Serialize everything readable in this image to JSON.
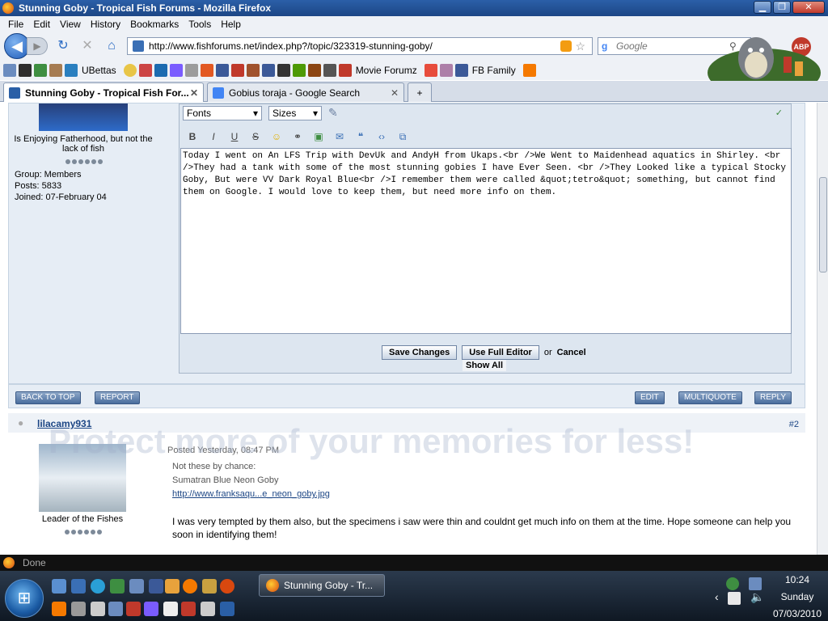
{
  "window": {
    "title": "Stunning Goby - Tropical Fish Forums - Mozilla Firefox",
    "min": "▁",
    "max": "❐",
    "close": "✕"
  },
  "menu": [
    "File",
    "Edit",
    "View",
    "History",
    "Bookmarks",
    "Tools",
    "Help"
  ],
  "nav": {
    "url": "http://www.fishforums.net/index.php?/topic/323319-stunning-goby/",
    "search_placeholder": "Google",
    "search_engine": "g",
    "abp": "ABP"
  },
  "bookmarks": {
    "ubettas": "UBettas",
    "movie_forumz": "Movie Forumz",
    "fb_family": "FB Family",
    "colors": [
      "#6b8cbf",
      "#2d2d2d",
      "#3e8e41",
      "#a67c52",
      "#2a7fbf",
      "#e8c547",
      "#cc4444",
      "#1c6bb0",
      "#7a5cff",
      "#9c9c9c",
      "#e25822",
      "#3b5998",
      "#c0392b",
      "#a0522d",
      "#3b5998",
      "#333333",
      "#4e9a06",
      "#8b4513",
      "#555555",
      "#c0392b",
      "#e74c3c",
      "#ad7fa8",
      "#3b5998",
      "#f57900"
    ]
  },
  "tabs": [
    {
      "label": "Stunning Goby - Tropical Fish For...",
      "close": "✕"
    },
    {
      "label": "Gobius toraja - Google Search",
      "close": "✕"
    },
    {
      "label": "+"
    }
  ],
  "post1": {
    "title": "Is Enjoying Fatherhood, but not the lack of fish",
    "group": "Group: Members",
    "posts": "Posts: 5833",
    "joined": "Joined: 07-February 04"
  },
  "editor": {
    "fonts": "Fonts",
    "sizes": "Sizes",
    "text": "Today I went on An LFS Trip with DevUk and AndyH from Ukaps.<br />We Went to Maidenhead aquatics in Shirley. <br />They had a tank with some of the most stunning gobies I have Ever Seen. <br />They Looked like a typical Stocky Goby, But were VV Dark Royal Blue<br />I remember them were called &quot;tetro&quot; something, but cannot find them on Google. I would love to keep them, but need more info on them.",
    "save": "Save Changes",
    "full": "Use Full Editor",
    "or": "or",
    "cancel": "Cancel",
    "show_all": "Show All"
  },
  "actions": {
    "back_to_top": "BACK TO TOP",
    "report": "REPORT",
    "edit": "EDIT",
    "multiquote": "MULTIQUOTE",
    "reply": "REPLY"
  },
  "post2": {
    "author": "lilacamy931",
    "number": "#2",
    "posted": "Posted Yesterday, 08:47 PM",
    "rank": "Leader of the Fishes",
    "q1": "Not these by chance:",
    "q2": "Sumatran Blue Neon Goby",
    "link": "http://www.franksaqu...e_neon_goby.jpg",
    "body": "I was very tempted by them also, but the specimens i saw were thin and couldnt get much info on them at the time. Hope someone can help you soon in identifying them!"
  },
  "watermark": "Protect more of your memories for less!",
  "status": "Done",
  "taskbar": {
    "window": "Stunning Goby - Tr...",
    "time": "10:24",
    "day": "Sunday",
    "date": "07/03/2010"
  }
}
